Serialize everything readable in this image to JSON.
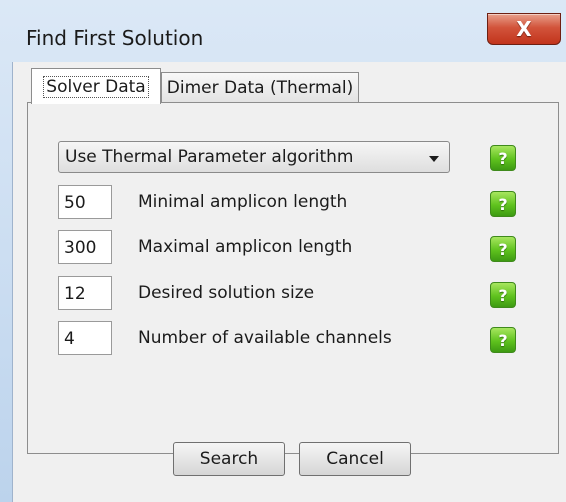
{
  "window": {
    "title": "Find First Solution",
    "close_glyph": "X"
  },
  "tabs": [
    {
      "label": "Solver Data",
      "active": true
    },
    {
      "label": "Dimer Data (Thermal)",
      "active": false
    }
  ],
  "algorithm_select": {
    "selected": "Use Thermal Parameter algorithm"
  },
  "fields": [
    {
      "value": "50",
      "label": "Minimal amplicon length"
    },
    {
      "value": "300",
      "label": "Maximal amplicon length"
    },
    {
      "value": "12",
      "label": "Desired solution size"
    },
    {
      "value": "4",
      "label": "Number of available channels"
    }
  ],
  "help_glyph": "?",
  "buttons": {
    "search": "Search",
    "cancel": "Cancel"
  },
  "colors": {
    "help_green": "#5fc21e",
    "close_red": "#c2341c",
    "titlebar_blue": "#c9dcf1"
  }
}
